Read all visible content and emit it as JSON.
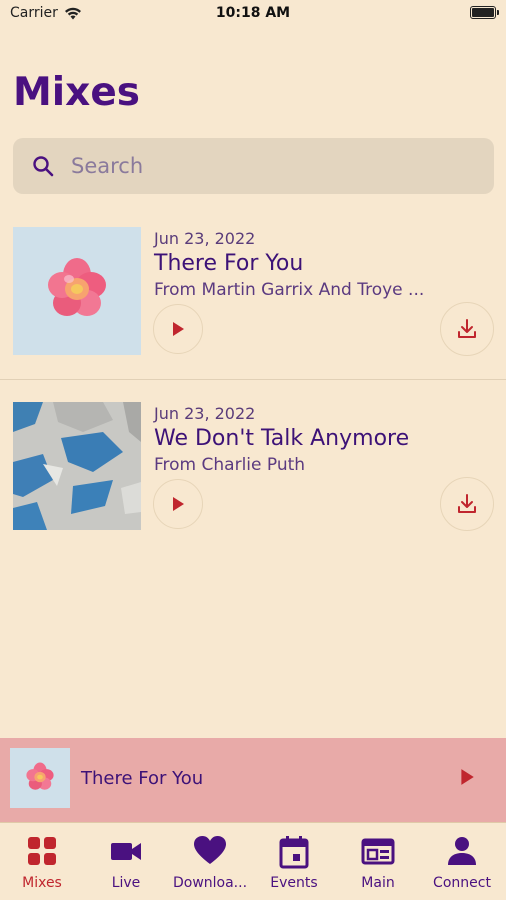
{
  "status_bar": {
    "carrier": "Carrier",
    "time": "10:18 AM"
  },
  "page_title": "Mixes",
  "search": {
    "placeholder": "Search"
  },
  "mixes": [
    {
      "date": "Jun 23, 2022",
      "title": "There For You",
      "subtitle": "From Martin Garrix And Troye ...",
      "thumb_icon": "pink-flower-image"
    },
    {
      "date": "Jun 23, 2022",
      "title": "We Don't Talk Anymore",
      "subtitle": "From Charlie Puth",
      "thumb_icon": "broken-glass-image"
    }
  ],
  "mini_player": {
    "title": "There For You"
  },
  "tabs": [
    {
      "label": "Mixes",
      "icon": "grid-icon",
      "active": true
    },
    {
      "label": "Live",
      "icon": "video-camera-icon",
      "active": false
    },
    {
      "label": "Downloa...",
      "icon": "heart-icon",
      "active": false
    },
    {
      "label": "Events",
      "icon": "calendar-icon",
      "active": false
    },
    {
      "label": "Main",
      "icon": "card-icon",
      "active": false
    },
    {
      "label": "Connect",
      "icon": "person-icon",
      "active": false
    }
  ],
  "colors": {
    "background": "#f8e8d0",
    "title_purple": "#4a1180",
    "accent_red": "#c0262e",
    "mini_player_bg": "#e8aaa8",
    "search_bg": "#e3d5bf"
  }
}
